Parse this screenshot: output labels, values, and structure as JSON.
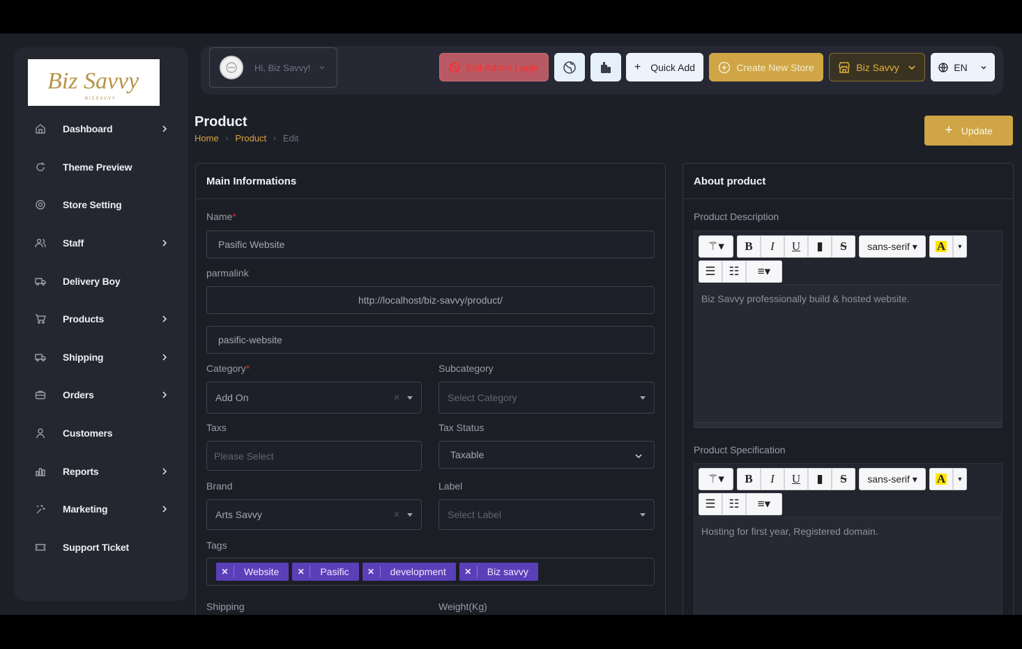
{
  "sidebar": {
    "logo_alt": "Biz Savvy",
    "items": [
      {
        "label": "Dashboard",
        "icon": "home-icon",
        "has_sub": true
      },
      {
        "label": "Theme Preview",
        "icon": "refresh-icon",
        "has_sub": false
      },
      {
        "label": "Store Setting",
        "icon": "settings-icon",
        "has_sub": false
      },
      {
        "label": "Staff",
        "icon": "users-icon",
        "has_sub": true
      },
      {
        "label": "Delivery Boy",
        "icon": "truck-icon",
        "has_sub": false
      },
      {
        "label": "Products",
        "icon": "cart-icon",
        "has_sub": true
      },
      {
        "label": "Shipping",
        "icon": "truck-icon",
        "has_sub": true
      },
      {
        "label": "Orders",
        "icon": "briefcase-icon",
        "has_sub": true
      },
      {
        "label": "Customers",
        "icon": "user-icon",
        "has_sub": false
      },
      {
        "label": "Reports",
        "icon": "chart-icon",
        "has_sub": true
      },
      {
        "label": "Marketing",
        "icon": "sparkle-icon",
        "has_sub": true
      },
      {
        "label": "Support Ticket",
        "icon": "ticket-icon",
        "has_sub": false
      }
    ]
  },
  "topbar": {
    "greeting": "Hi, Biz Savvy!",
    "exit_admin": "Exit Admin Login",
    "quick_add": "Quick Add",
    "create_store": "Create New Store",
    "store_name": "Biz Savvy",
    "language": "EN"
  },
  "header": {
    "title": "Product",
    "breadcrumb": [
      "Home",
      "Product",
      "Edit"
    ],
    "update_label": "Update"
  },
  "main_info": {
    "title": "Main Informations",
    "name_label": "Name",
    "name_value": "Pasific Website",
    "permalink_label": "parmalink",
    "permalink_base": "http://localhost/biz-savvy/product/",
    "permalink_slug": "pasific-website",
    "category_label": "Category",
    "category_value": "Add On",
    "subcategory_label": "Subcategory",
    "subcategory_placeholder": "Select Category",
    "taxs_label": "Taxs",
    "taxs_placeholder": "Please Select",
    "tax_status_label": "Tax Status",
    "tax_status_value": "Taxable",
    "brand_label": "Brand",
    "brand_value": "Arts Savvy",
    "label_label": "Label",
    "label_placeholder": "Select Label",
    "tags_label": "Tags",
    "tags": [
      "Website",
      "Pasific",
      "development",
      "Biz savvy"
    ],
    "shipping_label": "Shipping",
    "weight_label": "Weight(Kg)"
  },
  "about": {
    "title": "About product",
    "description_label": "Product Description",
    "description_text": "Biz Savvy professionally build & hosted website.",
    "specification_label": "Product Specification",
    "specification_text": "Hosting for first year, Registered domain.",
    "font_name": "sans-serif",
    "text_color_letter": "A",
    "bold": "B",
    "italic": "I",
    "underline": "U",
    "strike": "S"
  },
  "colors": {
    "accent_gold": "#cfa545",
    "tag_purple": "#5b3fb8",
    "danger": "#ff2b2b"
  }
}
